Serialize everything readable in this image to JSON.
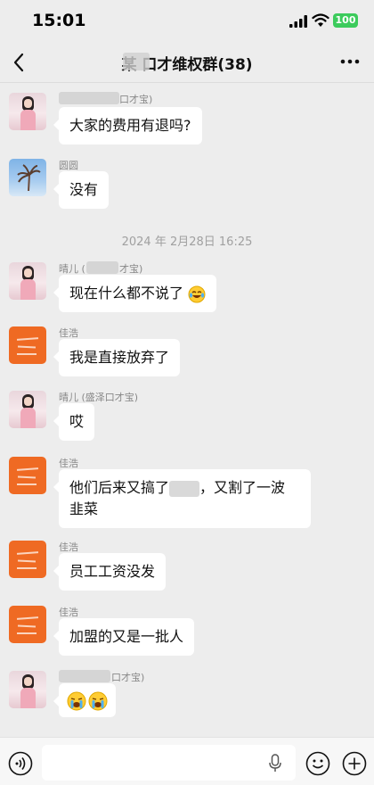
{
  "status_bar": {
    "time": "15:01",
    "battery": "100"
  },
  "header": {
    "title": "某   口才维权群(38)"
  },
  "messages": [
    {
      "sender": "口才宝)",
      "text": "大家的费用有退吗?"
    },
    {
      "sender": "圆圆",
      "text": "没有"
    },
    {
      "sender": "晴儿 (",
      "sender_suffix": "才宝)",
      "text": "现在什么都不说了"
    },
    {
      "sender": "佳浩",
      "text": "我是直接放弃了"
    },
    {
      "sender": "晴儿 (盛泽口才宝)",
      "text": "哎"
    },
    {
      "sender": "佳浩",
      "text_line1_a": "他们后来又搞了",
      "text_line1_b": "，又割了一波",
      "text_line2": "韭菜"
    },
    {
      "sender": "佳浩",
      "text": "员工工资没发"
    },
    {
      "sender": "佳浩",
      "text": "加盟的又是一批人"
    },
    {
      "sender": "口才宝)",
      "text": ""
    }
  ],
  "timestamp": "2024 年 2月28日 16:25",
  "input_bar": {
    "placeholder": ""
  },
  "colors": {
    "background": "#ededed",
    "bubble": "#ffffff",
    "battery": "#3ccb5c",
    "avatar_orange": "#ef6a23"
  },
  "icons": [
    "signal-icon",
    "wifi-icon",
    "back-icon",
    "more-icon",
    "voice-icon",
    "mic-icon",
    "emoji-icon",
    "plus-icon",
    "laugh-cry-emoji",
    "crying-emoji"
  ]
}
